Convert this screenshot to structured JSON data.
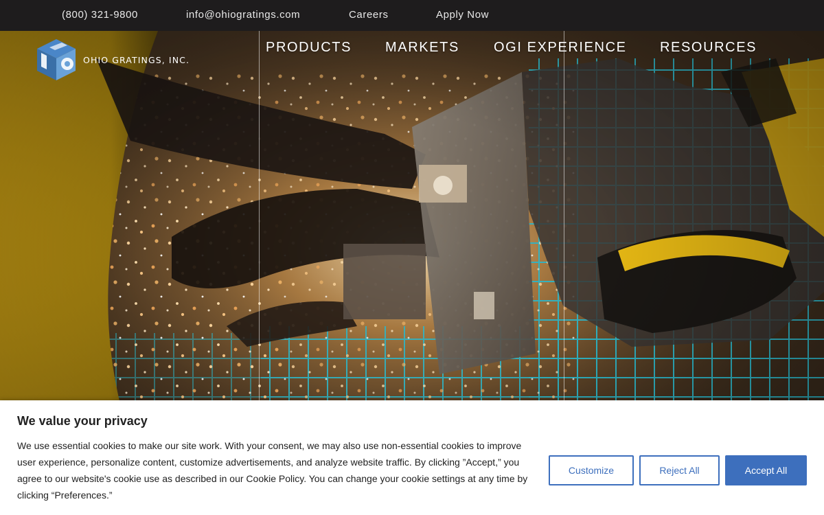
{
  "topbar": {
    "phone": "(800) 321-9800",
    "email": "info@ohiogratings.com",
    "careers": "Careers",
    "apply": "Apply Now"
  },
  "logo": {
    "text": "OHIO GRATINGS, INC.",
    "icon": "ohio-gratings-cube-logo"
  },
  "nav": {
    "items": [
      {
        "label": "PRODUCTS"
      },
      {
        "label": "MARKETS"
      },
      {
        "label": "OGI EXPERIENCE"
      },
      {
        "label": "RESOURCES"
      }
    ]
  },
  "hero": {
    "image": "robotic welding arm with sparks over teal steel grating"
  },
  "cookie": {
    "title": "We value your privacy",
    "text": "We use essential cookies to make our site work. With your consent, we may also use non-essential cookies to improve user experience, personalize content, customize advertisements, and analyze website traffic. By clicking ”Accept,” you agree to our website's cookie use as described in our Cookie Policy. You can change your cookie settings at any time by clicking “Preferences.”",
    "buttons": {
      "customize": "Customize",
      "reject": "Reject All",
      "accept": "Accept All"
    }
  },
  "colors": {
    "topbar_bg": "#1e1c1d",
    "accent_blue": "#3d6fbd",
    "grating_teal": "#2fb4c4",
    "robot_yellow": "#f2c21a"
  }
}
